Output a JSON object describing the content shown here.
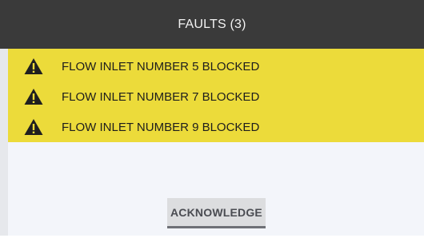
{
  "dialog": {
    "title": "FAULTS (3)",
    "faults": [
      {
        "icon": "warning-triangle-icon",
        "text": "FLOW INLET NUMBER 5 BLOCKED"
      },
      {
        "icon": "warning-triangle-icon",
        "text": "FLOW INLET NUMBER 7 BLOCKED"
      },
      {
        "icon": "warning-triangle-icon",
        "text": "FLOW INLET NUMBER 9 BLOCKED"
      }
    ],
    "acknowledge_label": "ACKNOWLEDGE"
  },
  "colors": {
    "titlebar": "#3a3a3a",
    "fault_highlight": "#ecdb3a",
    "body": "#f3f5fa",
    "button": "#dcdddf"
  }
}
